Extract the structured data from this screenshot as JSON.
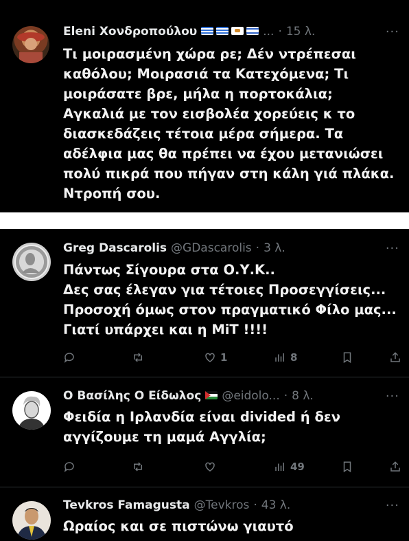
{
  "tweets": [
    {
      "name": "Eleni Χονδροπούλου",
      "flags": [
        "greece-flag",
        "greece-flag",
        "cyprus-flag",
        "israel-flag"
      ],
      "handle": "",
      "ellipsis": "...",
      "dot": "·",
      "time": "15 λ.",
      "more": "···",
      "lines": [
        "Τι μοιρασμένη χώρα ρε; Δέν ντρέπεσαι",
        "καθόλου; Μοιρασιά τα Κατεχόμενα; Τι",
        "μοιράσατε βρε, μήλα η  πορτοκάλια;",
        "Αγκαλιά με τον εισβολέα χορεύεις κ το",
        "διασκεδάζεις τέτοια μέρα σήμερα. Τα",
        "αδέλφια μας θα πρέπει να έχου μετανιώσει",
        "πολύ πικρά που πήγαν στη κάλη γιά πλάκα.",
        "Ντροπή σου."
      ]
    },
    {
      "name": "Greg Dascarolis",
      "handle": "@GDascarolis",
      "dot": "·",
      "time": "3 λ.",
      "more": "···",
      "lines": [
        "Πάντως Σίγουρα στα Ο.Υ.Κ..",
        "Δες σας έλεγαν για τέτοιες Προσεγγίσεις...",
        "Προσοχή όμως στον πραγματικό Φίλο μας...",
        "Γιατί υπάρχει και η ΜiΤ !!!!"
      ],
      "stats": {
        "reply": "",
        "retweet": "",
        "like": "1",
        "views": "8"
      }
    },
    {
      "name": "Ο Βασίλης Ο Είδωλος",
      "flags": [
        "palestine-flag"
      ],
      "handle": "@eidolo...",
      "dot": "·",
      "time": "8 λ.",
      "more": "···",
      "lines": [
        "Φειδία η Ιρλανδία είναι divided ή δεν",
        "αγγίζουμε τη μαμά Αγγλία;"
      ],
      "stats": {
        "reply": "",
        "retweet": "",
        "like": "",
        "views": "49"
      }
    },
    {
      "name": "Tevkros Famagusta",
      "handle": "@Tevkros",
      "dot": "·",
      "time": "43 λ.",
      "more": "···",
      "lines": [
        "Ωραίος και σε πιστώνω γιαυτό"
      ]
    }
  ],
  "colors": {
    "background": "#000000",
    "text": "#e7e9ea",
    "muted": "#71767b",
    "divider": "#2f3336"
  }
}
